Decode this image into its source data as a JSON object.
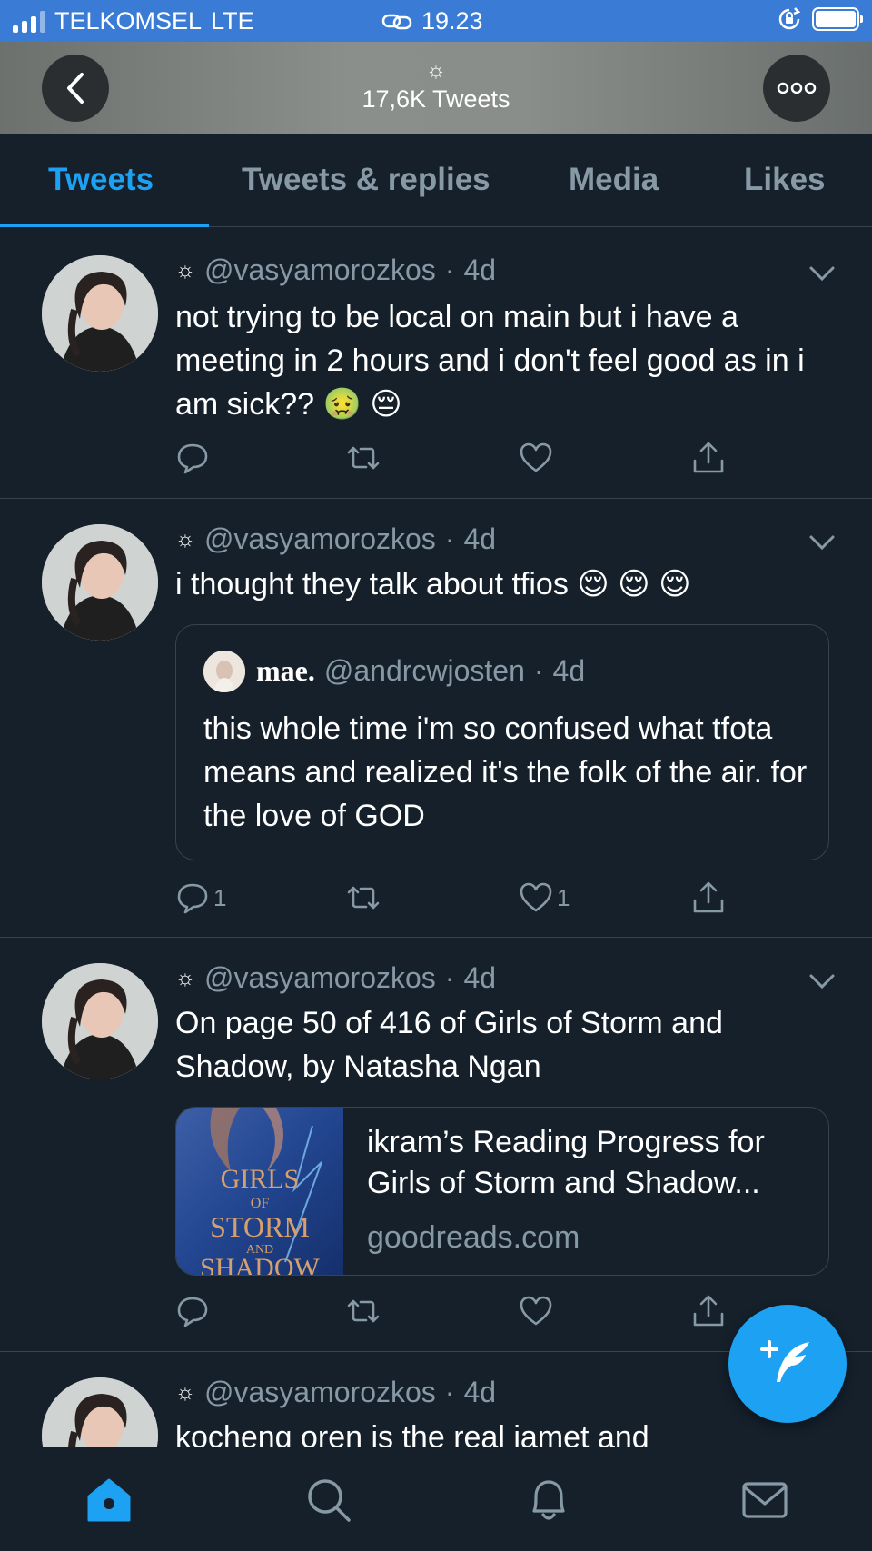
{
  "status_bar": {
    "carrier": "TELKOMSEL",
    "network": "LTE",
    "time": "19.23",
    "colors": {
      "background": "#3a7bd5"
    }
  },
  "header": {
    "count_label": "17,6K Tweets",
    "back_icon": "chevron-left-icon",
    "more_icon": "more-dots-icon"
  },
  "tabs": [
    {
      "label": "Tweets",
      "active": true
    },
    {
      "label": "Tweets & replies",
      "active": false
    },
    {
      "label": "Media",
      "active": false
    },
    {
      "label": "Likes",
      "active": false
    }
  ],
  "tweets": [
    {
      "handle": "@vasyamorozkos",
      "dot": "·",
      "time": "4d",
      "text": "not trying to be local on main but i have a meeting in 2 hours and i don't feel good as in i am sick?? 🤢 😔",
      "reply_count": "",
      "like_count": ""
    },
    {
      "handle": "@vasyamorozkos",
      "dot": "·",
      "time": "4d",
      "text": "i thought they talk about tfios 😌 😌 😌",
      "quote": {
        "name": "mae.",
        "handle": "@andrcwjosten",
        "dot": "·",
        "time": "4d",
        "text": "this whole time i'm so confused what tfota means and realized it's the folk of the air. for the love of GOD"
      },
      "reply_count": "1",
      "like_count": "1"
    },
    {
      "handle": "@vasyamorozkos",
      "dot": "·",
      "time": "4d",
      "text": "On page 50 of 416 of Girls of Storm and Shadow, by Natasha Ngan",
      "card": {
        "title": "ikram’s Reading Progress for Girls of Storm and Shadow...",
        "domain": "goodreads.com",
        "cover_text": [
          "GIRLS",
          "OF",
          "STORM",
          "AND",
          "SHADOW"
        ]
      },
      "reply_count": "",
      "like_count": ""
    },
    {
      "handle": "@vasyamorozkos",
      "dot": "·",
      "time": "4d",
      "text": "kocheng oren is the real jamet and"
    }
  ],
  "bottom_nav": [
    "home-icon",
    "search-icon",
    "notifications-bell-icon",
    "messages-envelope-icon"
  ],
  "colors": {
    "background": "#15202b",
    "accent": "#1da1f2",
    "muted": "#8899a6",
    "divider": "#38444d"
  }
}
